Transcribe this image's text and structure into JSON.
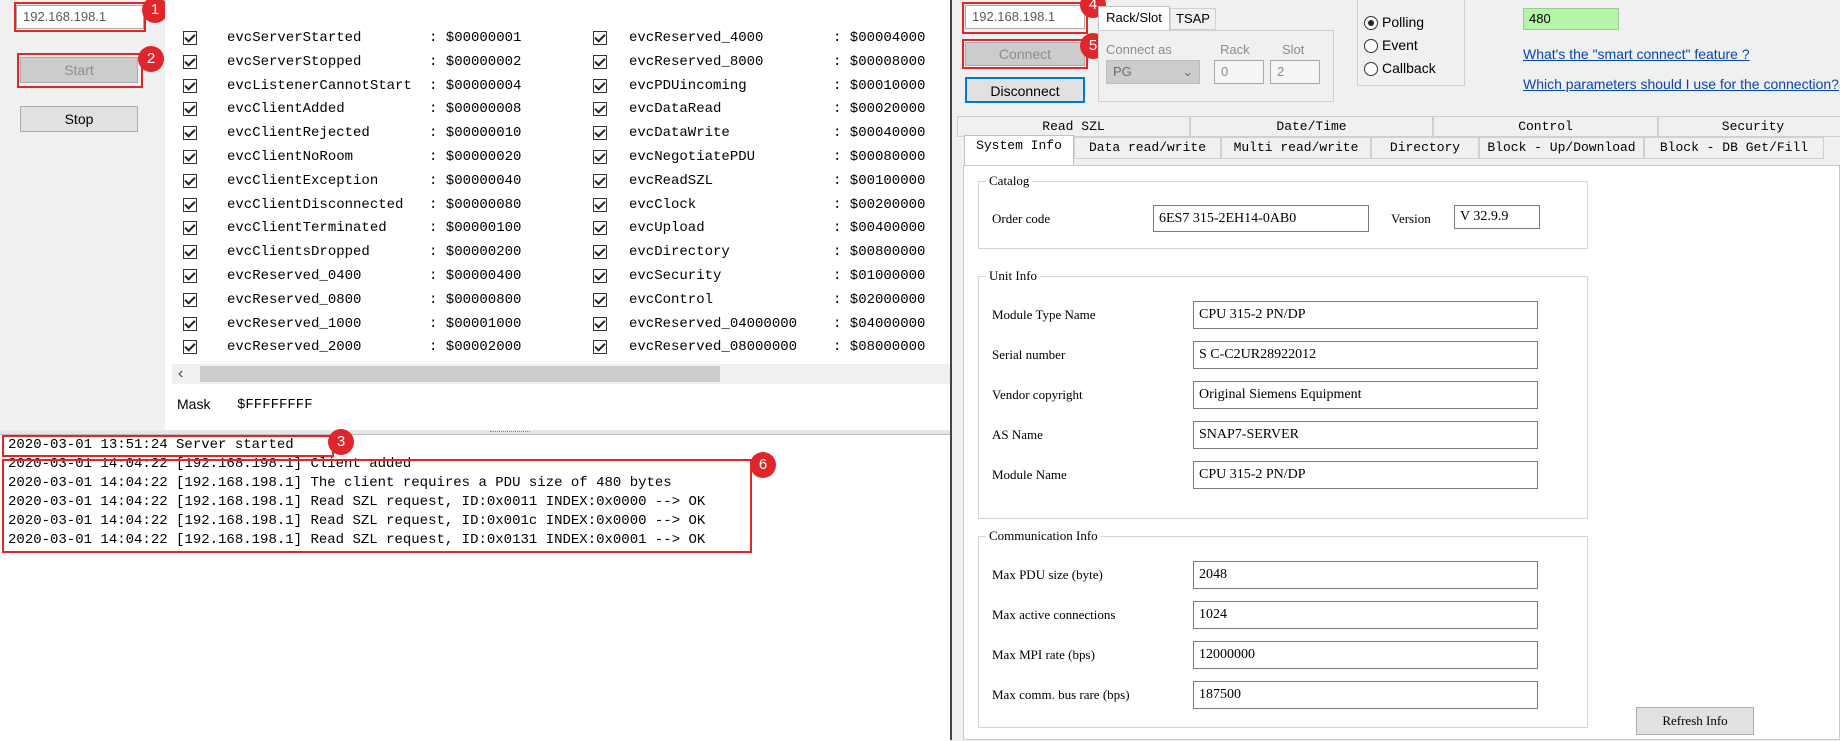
{
  "server": {
    "address": "192.168.198.1",
    "start_label": "Start",
    "stop_label": "Stop",
    "mask_label": "Mask",
    "mask_value": "$FFFFFFFF"
  },
  "events_col1": [
    {
      "name": "evcServerStarted",
      "value": ": $00000001"
    },
    {
      "name": "evcServerStopped",
      "value": ": $00000002"
    },
    {
      "name": "evcListenerCannotStart",
      "value": ": $00000004"
    },
    {
      "name": "evcClientAdded",
      "value": ": $00000008"
    },
    {
      "name": "evcClientRejected",
      "value": ": $00000010"
    },
    {
      "name": "evcClientNoRoom",
      "value": ": $00000020"
    },
    {
      "name": "evcClientException",
      "value": ": $00000040"
    },
    {
      "name": "evcClientDisconnected",
      "value": ": $00000080"
    },
    {
      "name": "evcClientTerminated",
      "value": ": $00000100"
    },
    {
      "name": "evcClientsDropped",
      "value": ": $00000200"
    },
    {
      "name": "evcReserved_0400",
      "value": ": $00000400"
    },
    {
      "name": "evcReserved_0800",
      "value": ": $00000800"
    },
    {
      "name": "evcReserved_1000",
      "value": ": $00001000"
    },
    {
      "name": "evcReserved_2000",
      "value": ": $00002000"
    }
  ],
  "events_col2": [
    {
      "name": "evcReserved_4000",
      "value": ": $00004000"
    },
    {
      "name": "evcReserved_8000",
      "value": ": $00008000"
    },
    {
      "name": "evcPDUincoming",
      "value": ": $00010000"
    },
    {
      "name": "evcDataRead",
      "value": ": $00020000"
    },
    {
      "name": "evcDataWrite",
      "value": ": $00040000"
    },
    {
      "name": "evcNegotiatePDU",
      "value": ": $00080000"
    },
    {
      "name": "evcReadSZL",
      "value": ": $00100000"
    },
    {
      "name": "evcClock",
      "value": ": $00200000"
    },
    {
      "name": "evcUpload",
      "value": ": $00400000"
    },
    {
      "name": "evcDirectory",
      "value": ": $00800000"
    },
    {
      "name": "evcSecurity",
      "value": ": $01000000"
    },
    {
      "name": "evcControl",
      "value": ": $02000000"
    },
    {
      "name": "evcReserved_04000000",
      "value": ": $04000000"
    },
    {
      "name": "evcReserved_08000000",
      "value": ": $08000000"
    }
  ],
  "log": [
    "2020-03-01 13:51:24 Server started",
    "2020-03-01 14:04:22 [192.168.198.1] Client added",
    "2020-03-01 14:04:22 [192.168.198.1] The client requires a PDU size of 480 bytes",
    "2020-03-01 14:04:22 [192.168.198.1] Read SZL request, ID:0x0011 INDEX:0x0000 --> OK",
    "2020-03-01 14:04:22 [192.168.198.1] Read SZL request, ID:0x001c INDEX:0x0000 --> OK",
    "2020-03-01 14:04:22 [192.168.198.1] Read SZL request, ID:0x0131 INDEX:0x0001 --> OK"
  ],
  "badges": [
    "1",
    "2",
    "3",
    "4",
    "5",
    "6"
  ],
  "client": {
    "address": "192.168.198.1",
    "connect_label": "Connect",
    "disconnect_label": "Disconnect",
    "tabs": [
      "Rack/Slot",
      "TSAP"
    ],
    "connect_as_label": "Connect as",
    "connect_as_value": "PG",
    "rack_label": "Rack",
    "rack_value": "0",
    "slot_label": "Slot",
    "slot_value": "2",
    "modes": [
      "Polling",
      "Event",
      "Callback"
    ],
    "pdu_value": "480",
    "link_smart": "What's the \"smart connect\" feature ?",
    "link_params": "Which parameters should I use for the connection?"
  },
  "tabs_row1": [
    "Read SZL",
    "Date/Time",
    "Control",
    "Security"
  ],
  "tabs_row2": [
    "System Info",
    "Data read/write",
    "Multi read/write",
    "Directory",
    "Block - Up/Download",
    "Block - DB Get/Fill"
  ],
  "catalog": {
    "title": "Catalog",
    "order_code_label": "Order code",
    "order_code": "6ES7 315-2EH14-0AB0",
    "version_label": "Version",
    "version": "V 32.9.9"
  },
  "unit_info": {
    "title": "Unit Info",
    "fields": [
      {
        "label": "Module Type Name",
        "value": "CPU 315-2 PN/DP"
      },
      {
        "label": "Serial number",
        "value": "S C-C2UR28922012"
      },
      {
        "label": "Vendor copyright",
        "value": "Original Siemens Equipment"
      },
      {
        "label": "AS Name",
        "value": "SNAP7-SERVER"
      },
      {
        "label": "Module Name",
        "value": "CPU 315-2 PN/DP"
      }
    ]
  },
  "comm_info": {
    "title": "Communication Info",
    "fields": [
      {
        "label": "Max PDU size (byte)",
        "value": "2048"
      },
      {
        "label": "Max active connections",
        "value": "1024"
      },
      {
        "label": "Max MPI rate (bps)",
        "value": "12000000"
      },
      {
        "label": "Max comm. bus rare (bps)",
        "value": "187500"
      }
    ]
  },
  "refresh_label": "Refresh Info"
}
